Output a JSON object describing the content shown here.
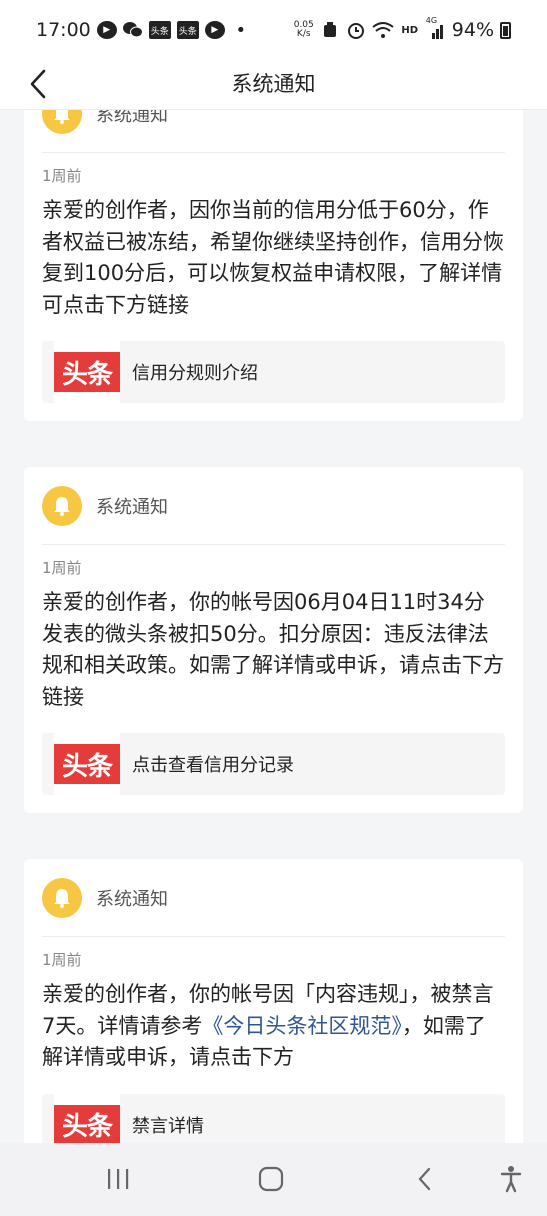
{
  "status_bar": {
    "time": "17:00",
    "app_badges": [
      "头条",
      "头条"
    ],
    "dot": "•",
    "net_speed_value": "0.05",
    "net_speed_unit": "K/s",
    "hd_label": "HD",
    "signal_label": "4G",
    "battery_percent": "94%"
  },
  "nav": {
    "title": "系统通知"
  },
  "notifications": [
    {
      "sender": "系统通知",
      "time": "1周前",
      "body": "亲爱的创作者，因你当前的信用分低于60分，作者权益已被冻结，希望你继续坚持创作，信用分恢复到100分后，可以恢复权益申请权限，了解详情可点击下方链接",
      "logo_text": "头条",
      "link_label": "信用分规则介绍"
    },
    {
      "sender": "系统通知",
      "time": "1周前",
      "body": "亲爱的创作者，你的帐号因06月04日11时34分发表的微头条被扣50分。扣分原因：违反法律法规和相关政策。如需了解详情或申诉，请点击下方链接",
      "logo_text": "头条",
      "link_label": "点击查看信用分记录"
    },
    {
      "sender": "系统通知",
      "time": "1周前",
      "body_before": "亲爱的创作者，你的帐号因「内容违规」，被禁言7天。详情请参考",
      "body_link": "《今日头条社区规范》",
      "body_after": "，如需了解详情或申诉，请点击下方",
      "logo_text": "头条",
      "link_label": "禁言详情"
    }
  ],
  "colors": {
    "bell": "#f7c744",
    "logo_red": "#e43b3b",
    "link_blue": "#2f5694"
  }
}
